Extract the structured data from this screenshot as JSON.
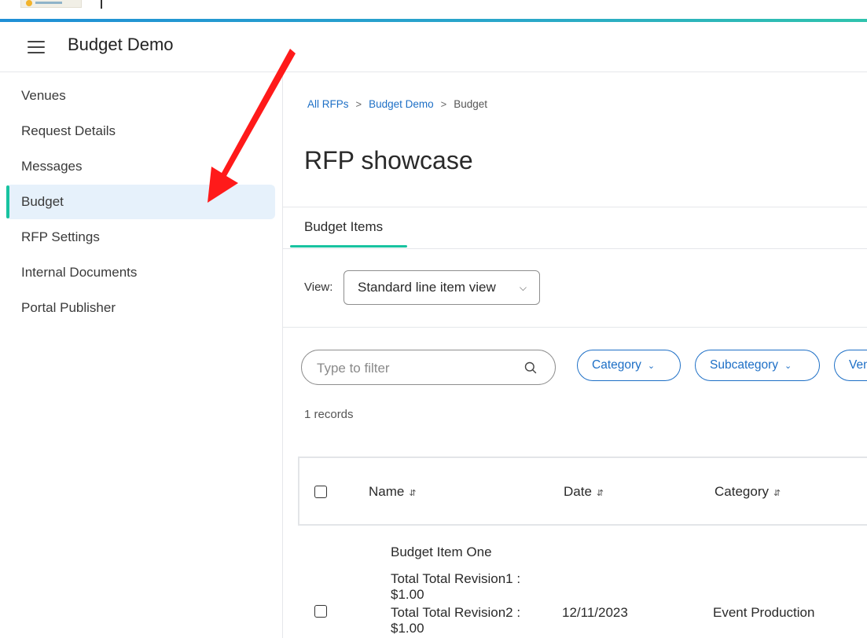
{
  "app": {
    "title": "Budget Demo"
  },
  "sidebar": {
    "items": [
      {
        "label": "Venues",
        "active": false
      },
      {
        "label": "Request Details",
        "active": false
      },
      {
        "label": "Messages",
        "active": false
      },
      {
        "label": "Budget",
        "active": true
      },
      {
        "label": "RFP Settings",
        "active": false
      },
      {
        "label": "Internal Documents",
        "active": false
      },
      {
        "label": "Portal Publisher",
        "active": false
      }
    ]
  },
  "breadcrumb": {
    "items": [
      "All RFPs",
      "Budget Demo",
      "Budget"
    ]
  },
  "page": {
    "title": "RFP showcase"
  },
  "tabs": [
    {
      "label": "Budget Items",
      "active": true
    }
  ],
  "view": {
    "label": "View:",
    "selected": "Standard line item view"
  },
  "filter": {
    "placeholder": "Type to filter",
    "chips": [
      "Category",
      "Subcategory",
      "Ven"
    ]
  },
  "records": "1 records",
  "table": {
    "columns": [
      "Name",
      "Date",
      "Category"
    ],
    "rows": [
      {
        "name": "Budget Item One",
        "revision1_label": "Total Total Revision1 :",
        "revision1_value": "$1.00",
        "revision2_label": "Total Total Revision2 :",
        "revision2_value": "$1.00",
        "date": "12/11/2023",
        "category": "Event Production"
      }
    ]
  },
  "colors": {
    "accent": "#18c3a0",
    "link": "#1d6fc6",
    "active_bg": "#e6f1fb",
    "arrow": "#ff1a1a"
  },
  "icons": [
    "menu-icon",
    "search-icon",
    "chevron-down-icon",
    "sort-icon",
    "chevron-right-icon"
  ]
}
